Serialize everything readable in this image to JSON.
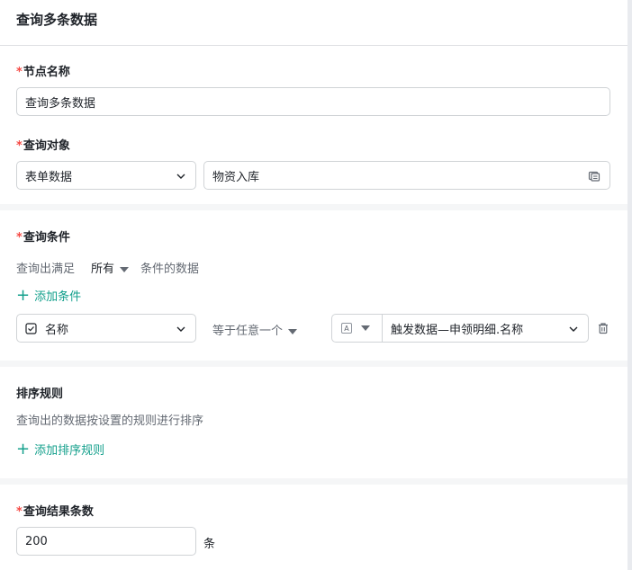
{
  "header": {
    "title": "查询多条数据"
  },
  "node_name": {
    "label": "节点名称",
    "required_mark": "*",
    "value": "查询多条数据"
  },
  "query_target": {
    "label": "查询对象",
    "required_mark": "*",
    "source_select": "表单数据",
    "form_input": "物资入库"
  },
  "query_conditions": {
    "label": "查询条件",
    "required_mark": "*",
    "prefix": "查询出满足",
    "mode": "所有",
    "suffix": "条件的数据",
    "add_label": "添加条件",
    "condition": {
      "field": "名称",
      "operator": "等于任意一个",
      "value_type": "A",
      "value": "触发数据—申领明细.名称"
    }
  },
  "sort_rules": {
    "label": "排序规则",
    "desc": "查询出的数据按设置的规则进行排序",
    "add_label": "添加排序规则"
  },
  "result_count": {
    "label": "查询结果条数",
    "required_mark": "*",
    "value": "200",
    "unit": "条"
  }
}
